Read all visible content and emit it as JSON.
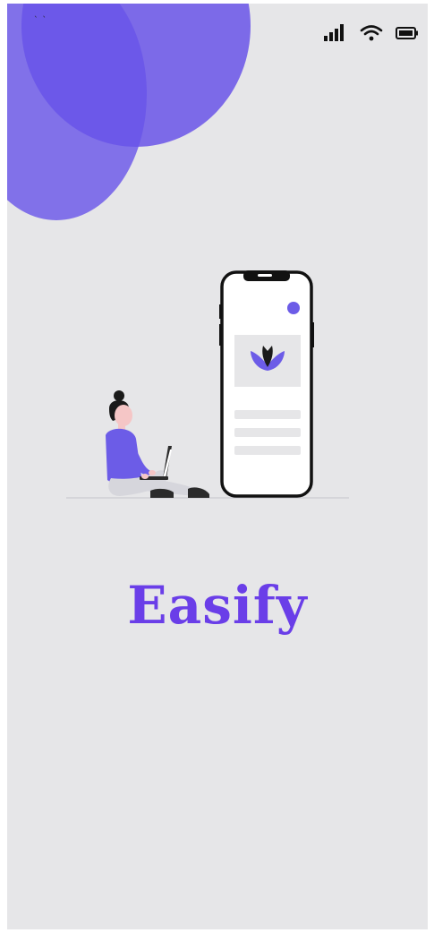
{
  "app": {
    "brand_name": "Easify",
    "brand_color": "#6a3ee8",
    "accent_color": "#6c5ce7",
    "background_color": "#e6e6e8"
  },
  "status_bar": {
    "icons": [
      "cellular-signal-icon",
      "wifi-icon",
      "battery-icon"
    ],
    "corner_marks": "` `"
  },
  "illustration": {
    "subject": "person-with-laptop-and-phone-illustration",
    "logo_icon": "tulip-logo-icon"
  }
}
